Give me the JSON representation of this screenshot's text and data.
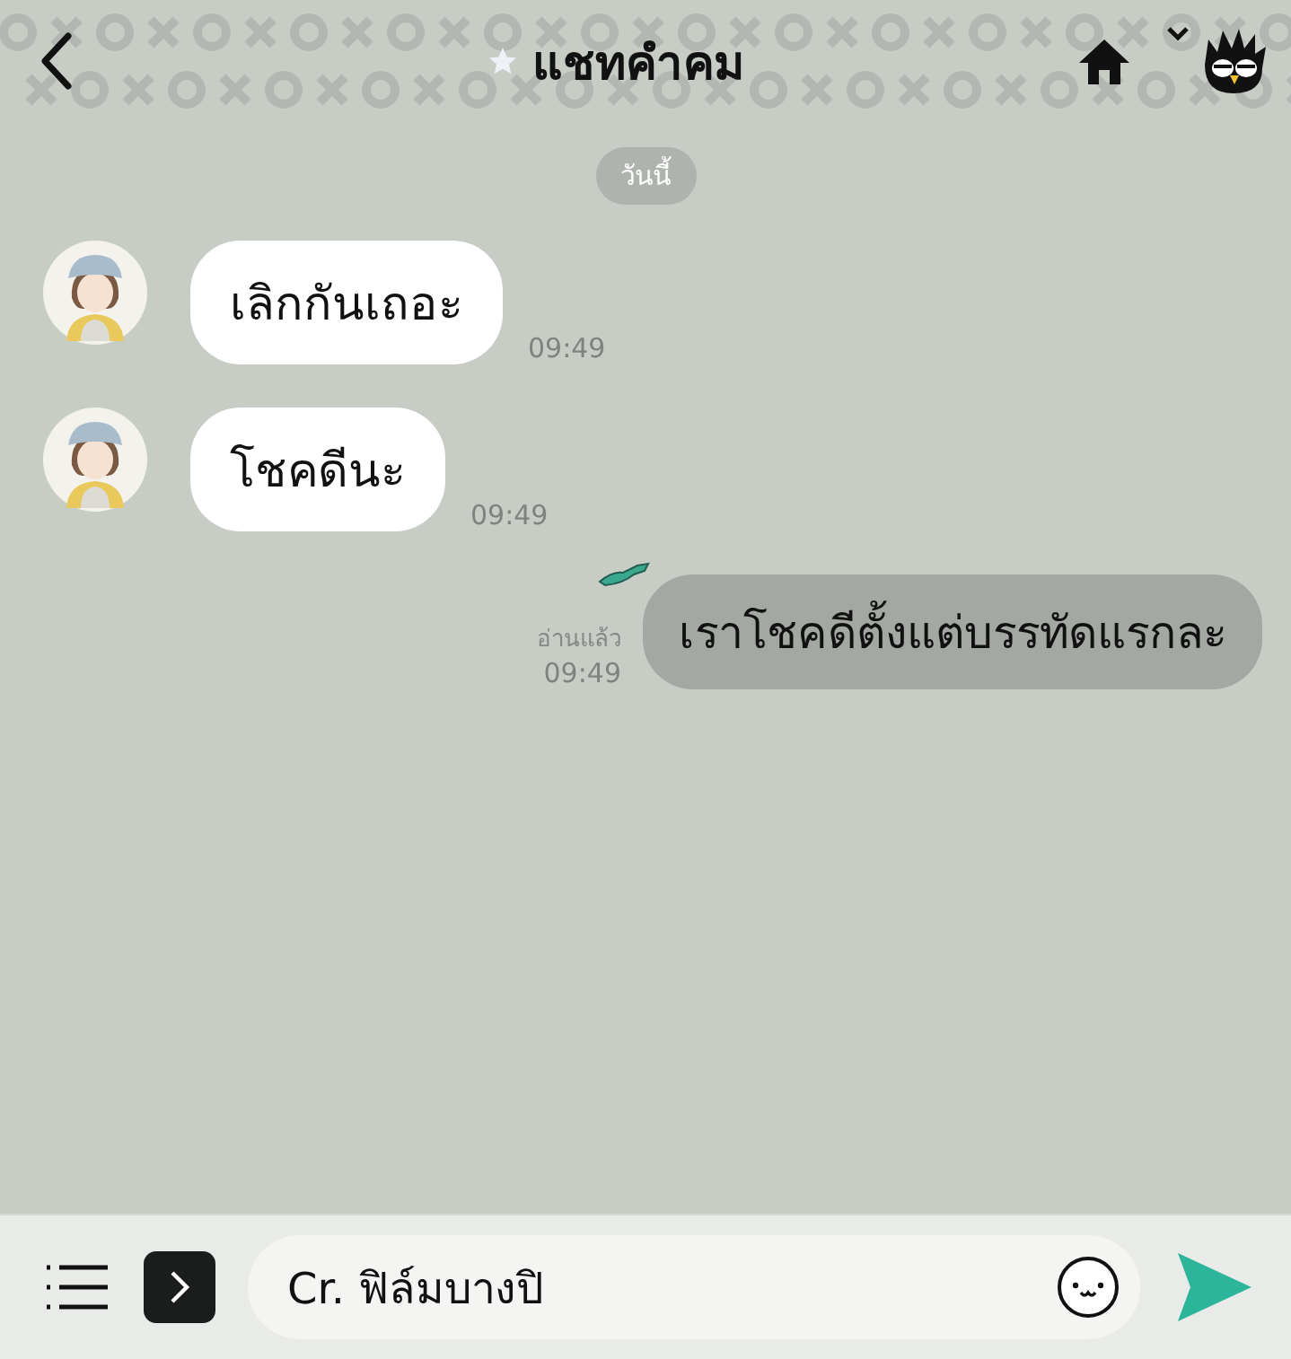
{
  "header": {
    "title": "แชทคำคม",
    "favorite": true
  },
  "date_label": "วันนี้",
  "messages": [
    {
      "kind": "incoming",
      "text": "เลิกกันเถอะ",
      "time": "09:49"
    },
    {
      "kind": "incoming",
      "text": "โชคดีนะ",
      "time": "09:49"
    },
    {
      "kind": "outgoing",
      "text": "เราโชคดีตั้งแต่บรรทัดแรกละ",
      "time": "09:49",
      "read_label": "อ่านแล้ว"
    }
  ],
  "composer": {
    "value": "Cr. ฟิล์มบางปิ"
  }
}
